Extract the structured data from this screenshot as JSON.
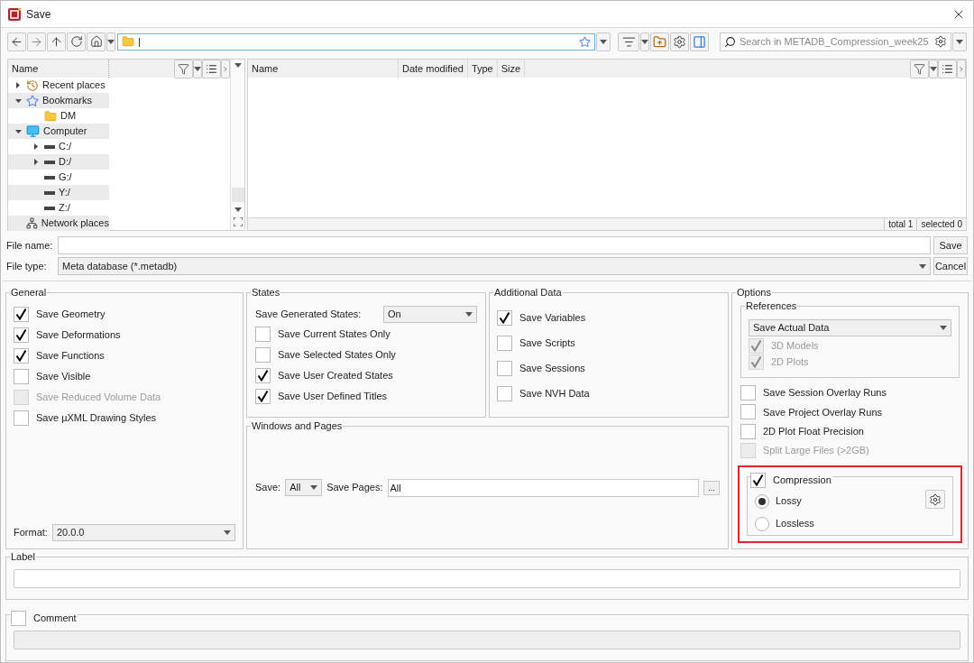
{
  "window": {
    "title": "Save"
  },
  "toolbar": {
    "path": "|",
    "search_placeholder": "Search in METADB_Compression_week25"
  },
  "tree": {
    "column": "Name",
    "items": [
      {
        "label": "Recent places",
        "kind": "recent",
        "expanded": false
      },
      {
        "label": "Bookmarks",
        "kind": "bookmarks",
        "expanded": true,
        "children": [
          {
            "label": "DM",
            "kind": "folder"
          }
        ]
      },
      {
        "label": "Computer",
        "kind": "computer",
        "expanded": true,
        "children": [
          {
            "label": "C:/",
            "kind": "drive",
            "expanded": false
          },
          {
            "label": "D:/",
            "kind": "drive",
            "expanded": false
          },
          {
            "label": "G:/",
            "kind": "drive"
          },
          {
            "label": "Y:/",
            "kind": "drive"
          },
          {
            "label": "Z:/",
            "kind": "drive"
          }
        ]
      },
      {
        "label": "Network places",
        "kind": "network"
      }
    ]
  },
  "files": {
    "columns": [
      "Name",
      "Date modified",
      "Type",
      "Size"
    ],
    "status": [
      "total 1",
      "selected 0"
    ]
  },
  "file_name": {
    "label": "File name:"
  },
  "file_type": {
    "label": "File type:",
    "value": "Meta database (*.metadb)"
  },
  "buttons": [
    "Save",
    "Cancel"
  ],
  "general": {
    "title": "General",
    "options": [
      {
        "label": "Save Geometry",
        "checked": true,
        "disabled": false
      },
      {
        "label": "Save Deformations",
        "checked": true,
        "disabled": false
      },
      {
        "label": "Save Functions",
        "checked": true,
        "disabled": false
      },
      {
        "label": "Save Visible",
        "checked": false,
        "disabled": false
      },
      {
        "label": "Save Reduced Volume Data",
        "checked": false,
        "disabled": true
      },
      {
        "label": "Save µXML Drawing Styles",
        "checked": false,
        "disabled": false
      }
    ],
    "format_label": "Format:",
    "format_value": "20.0.0"
  },
  "states": {
    "title": "States",
    "generated_label": "Save Generated States:",
    "generated_value": "On",
    "options": [
      {
        "label": "Save Current States Only",
        "checked": false,
        "disabled": false
      },
      {
        "label": "Save Selected States Only",
        "checked": false,
        "disabled": false
      },
      {
        "label": "Save User Created States",
        "checked": true,
        "disabled": false
      },
      {
        "label": "Save User Defined Titles",
        "checked": true,
        "disabled": false
      }
    ]
  },
  "additional": {
    "title": "Additional Data",
    "options": [
      {
        "label": "Save Variables",
        "checked": true,
        "disabled": false
      },
      {
        "label": "Save Scripts",
        "checked": false,
        "disabled": false
      },
      {
        "label": "Save Sessions",
        "checked": false,
        "disabled": false
      },
      {
        "label": "Save NVH Data",
        "checked": false,
        "disabled": false
      }
    ]
  },
  "windows_pages": {
    "title": "Windows and Pages",
    "save_label": "Save:",
    "save_value": "All",
    "pages_label": "Save Pages:",
    "pages_value": "All",
    "browse": "..."
  },
  "options": {
    "title": "Options",
    "references": {
      "title": "References",
      "mode": "Save Actual Data",
      "options": [
        {
          "label": "3D Models",
          "checked": true,
          "disabled": true
        },
        {
          "label": "2D Plots",
          "checked": true,
          "disabled": true
        }
      ]
    },
    "items": [
      {
        "label": "Save Session Overlay Runs",
        "checked": false,
        "disabled": false
      },
      {
        "label": "Save Project Overlay Runs",
        "checked": false,
        "disabled": false
      },
      {
        "label": "2D Plot Float Precision",
        "checked": false,
        "disabled": false
      },
      {
        "label": "Split Large Files (>2GB)",
        "checked": false,
        "disabled": true
      }
    ],
    "compression": {
      "label": "Compression",
      "checked": true,
      "highlighted": true,
      "modes": [
        {
          "label": "Lossy",
          "selected": true
        },
        {
          "label": "Lossless",
          "selected": false
        }
      ]
    }
  },
  "label_group": {
    "title": "Label"
  },
  "comment_group": {
    "title": "Comment",
    "checked": false
  }
}
